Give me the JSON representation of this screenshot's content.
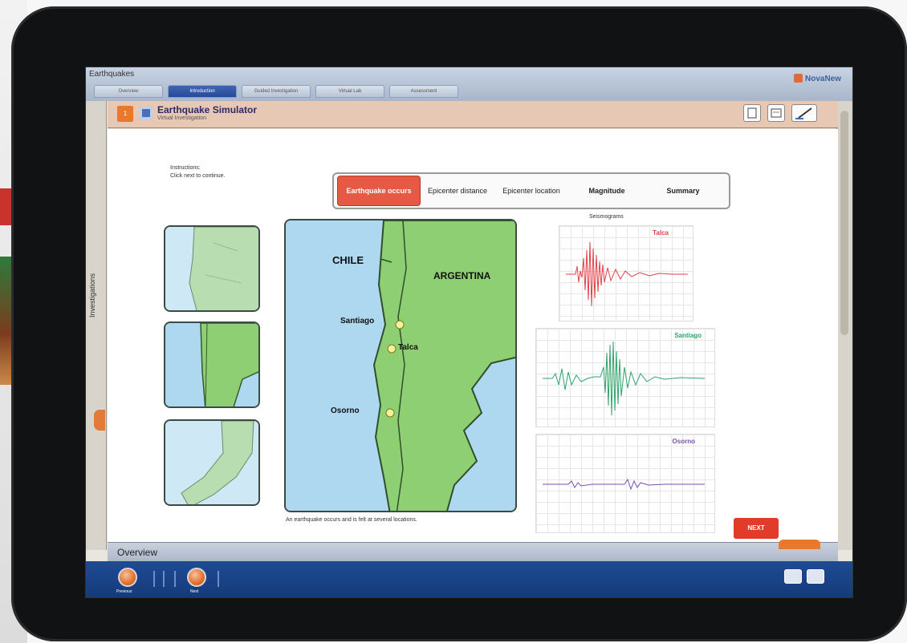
{
  "app": {
    "title": "Earthquakes",
    "logo": "NovaNew"
  },
  "tabs": [
    {
      "label": "Overview"
    },
    {
      "label": "Introduction"
    },
    {
      "label": "Guided Investigation"
    },
    {
      "label": "Virtual Lab"
    },
    {
      "label": "Assessment"
    }
  ],
  "left_rail": {
    "label": "Investigations"
  },
  "lesson": {
    "number": "1",
    "title": "Earthquake Simulator",
    "subtitle": "Virtual Investigation"
  },
  "instructions": {
    "heading": "Instructions:",
    "body": "Click next to continue."
  },
  "steps": [
    {
      "label": "Earthquake occurs",
      "active": true
    },
    {
      "label": "Epicenter distance",
      "active": false
    },
    {
      "label": "Epicenter location",
      "active": false
    },
    {
      "label": "Magnitude",
      "active": false
    },
    {
      "label": "Summary",
      "active": false
    }
  ],
  "map": {
    "countries": {
      "chile": "CHILE",
      "argentina": "ARGENTINA"
    },
    "cities": [
      {
        "name": "Santiago"
      },
      {
        "name": "Talca"
      },
      {
        "name": "Osorno"
      }
    ],
    "caption": "An earthquake occurs and is felt at several locations."
  },
  "seismograms": {
    "title": "Seismograms",
    "stations": [
      {
        "name": "Talca",
        "color": "#e0424a"
      },
      {
        "name": "Santiago",
        "color": "#2fa36a"
      },
      {
        "name": "Osorno",
        "color": "#7a4fb0"
      }
    ]
  },
  "buttons": {
    "next": "NEXT"
  },
  "overview": {
    "label": "Overview"
  },
  "bottom": {
    "left_label": "Previous",
    "mid_label": "Next"
  }
}
